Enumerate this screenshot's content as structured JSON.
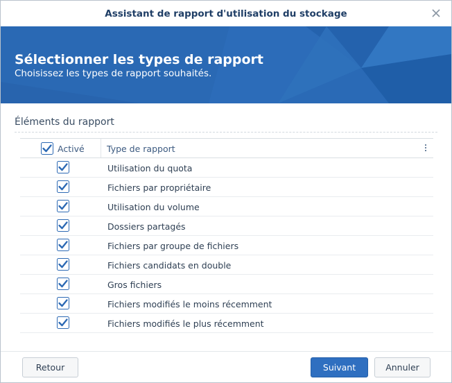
{
  "dialog": {
    "title": "Assistant de rapport d'utilisation du stockage",
    "close_icon": "close-icon"
  },
  "banner": {
    "title": "Sélectionner les types de rapport",
    "subtitle": "Choisissez les types de rapport souhaités."
  },
  "section": {
    "title": "Éléments du rapport"
  },
  "grid": {
    "header": {
      "active_label": "Activé",
      "type_label": "Type de rapport",
      "active_checked": true
    },
    "rows": [
      {
        "label": "Utilisation du quota",
        "checked": true
      },
      {
        "label": "Fichiers par propriétaire",
        "checked": true
      },
      {
        "label": "Utilisation du volume",
        "checked": true
      },
      {
        "label": "Dossiers partagés",
        "checked": true
      },
      {
        "label": "Fichiers par groupe de fichiers",
        "checked": true
      },
      {
        "label": "Fichiers candidats en double",
        "checked": true
      },
      {
        "label": "Gros fichiers",
        "checked": true
      },
      {
        "label": "Fichiers modifiés le moins récemment",
        "checked": true
      },
      {
        "label": "Fichiers modifiés le plus récemment",
        "checked": true
      }
    ]
  },
  "footer": {
    "back_label": "Retour",
    "next_label": "Suivant",
    "cancel_label": "Annuler"
  },
  "colors": {
    "accent": "#2f6fc0",
    "banner": "#2a69b4",
    "title_text": "#1f3e66",
    "checkbox": "#2c69b4"
  }
}
